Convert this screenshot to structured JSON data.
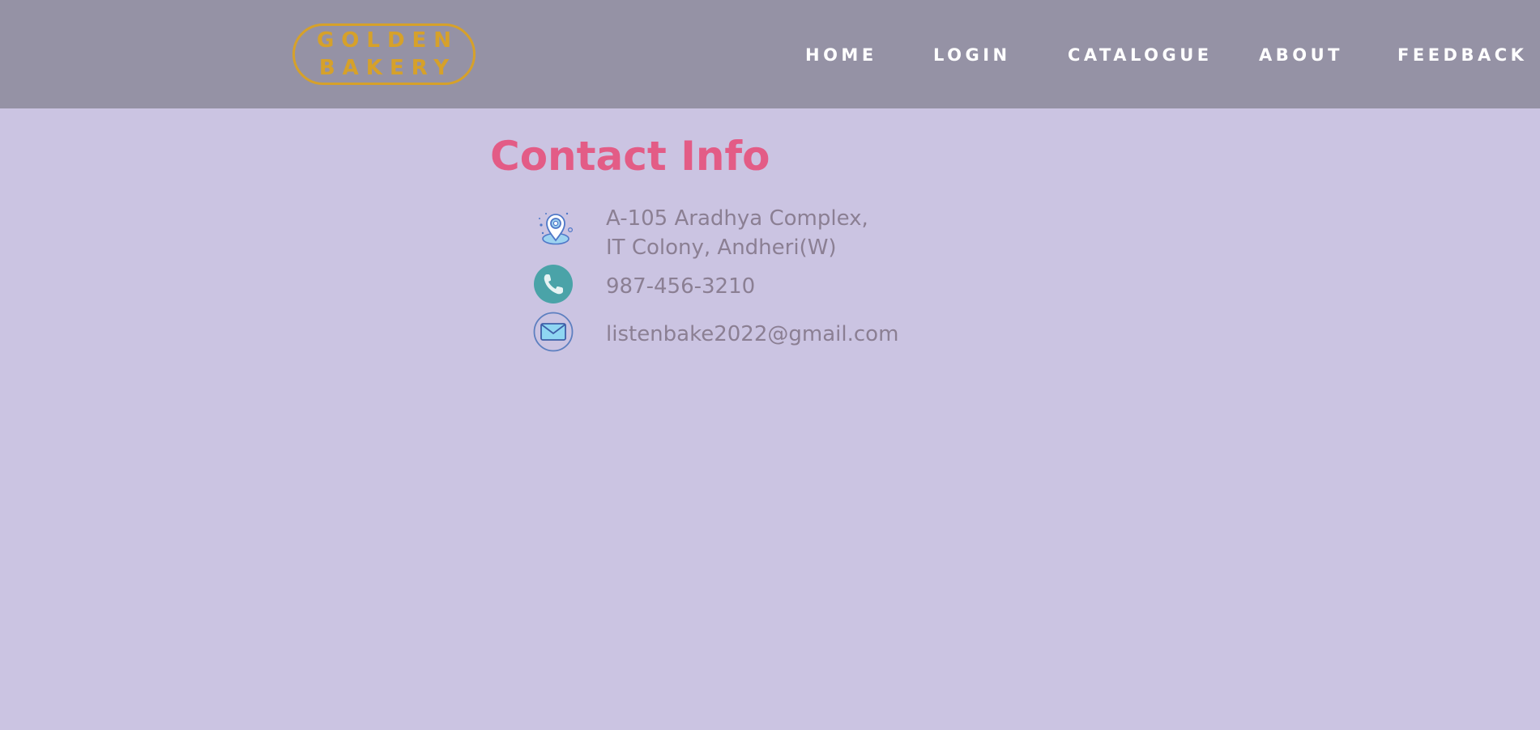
{
  "brand": {
    "line1": "GOLDEN",
    "line2": "BAKERY",
    "color": "#d6a12a"
  },
  "nav": {
    "items": [
      {
        "label": "HOME"
      },
      {
        "label": "LOGIN"
      },
      {
        "label": "CATALOGUE"
      },
      {
        "label": "ABOUT"
      },
      {
        "label": "FEEDBACK"
      }
    ]
  },
  "contact": {
    "title": "Contact Info",
    "title_color": "#e35c86",
    "address_line1": "A-105 Aradhya Complex,",
    "address_line2": "IT Colony, Andheri(W)",
    "phone": "987-456-3210",
    "email": "listenbake2022@gmail.com",
    "icons": [
      "location-pin-icon",
      "phone-icon",
      "email-icon"
    ]
  },
  "colors": {
    "header_bg": "#9592a5",
    "page_bg": "#cbc4e2",
    "text_muted": "#8b7f93"
  }
}
